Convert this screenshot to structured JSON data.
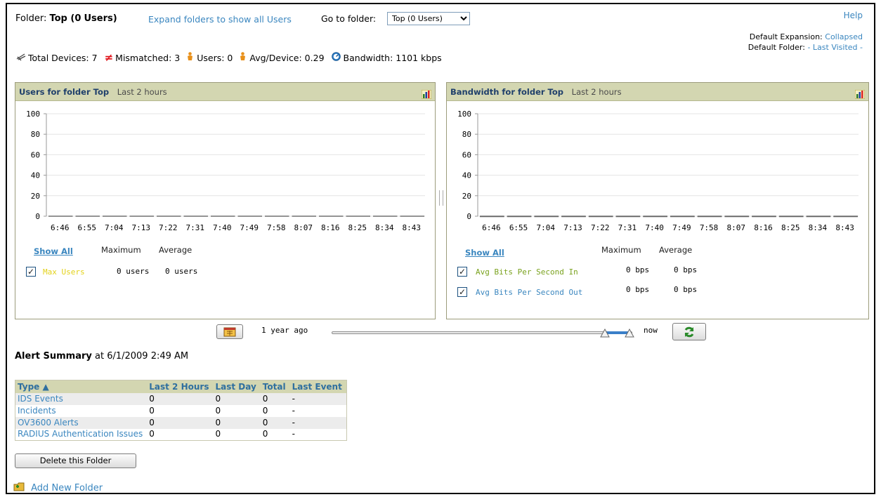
{
  "header": {
    "folder_label": "Folder:",
    "folder_name": "Top (0",
    "folder_users": "Users)",
    "expand_link": "Expand folders to show all Users",
    "goto_label": "Go to folder:",
    "goto_selected": "Top (0 Users)",
    "help_link": "Help",
    "default_expansion_label": "Default Expansion:",
    "default_expansion_value": "Collapsed",
    "default_folder_label": "Default Folder:",
    "default_folder_value": "- Last Visited -"
  },
  "stats": {
    "total_devices": "Total Devices: 7",
    "mismatched": "Mismatched: 3",
    "users": "Users: 0",
    "avg_device": "Avg/Device: 0.29",
    "bandwidth": "Bandwidth: 1101 kbps"
  },
  "users_panel": {
    "title": "Users for folder Top",
    "range": "Last 2 hours",
    "show_all": "Show All",
    "max_header": "Maximum",
    "avg_header": "Average",
    "series": [
      {
        "name": "Max Users",
        "max": "0 users",
        "avg": "0 users",
        "color": "#e3d21a"
      }
    ]
  },
  "bandwidth_panel": {
    "title": "Bandwidth for folder Top",
    "range": "Last 2 hours",
    "show_all": "Show All",
    "max_header": "Maximum",
    "avg_header": "Average",
    "series": [
      {
        "name": "Avg Bits Per Second In",
        "max": "0 bps",
        "avg": "0 bps",
        "color": "#7aa21e"
      },
      {
        "name": "Avg Bits Per Second Out",
        "max": "0 bps",
        "avg": "0 bps",
        "color": "#3a86bf"
      }
    ]
  },
  "chart_data": [
    {
      "type": "line",
      "title": "Users for folder Top",
      "x": [
        "6:46",
        "6:55",
        "7:04",
        "7:13",
        "7:22",
        "7:31",
        "7:40",
        "7:49",
        "7:58",
        "8:07",
        "8:16",
        "8:25",
        "8:34",
        "8:43"
      ],
      "yticks": [
        0,
        20,
        40,
        60,
        80,
        100
      ],
      "ylim": [
        0,
        100
      ],
      "grid": true,
      "series": [
        {
          "name": "Max Users",
          "values": [
            0,
            0,
            0,
            0,
            0,
            0,
            0,
            0,
            0,
            0,
            0,
            0,
            0,
            0
          ]
        }
      ]
    },
    {
      "type": "line",
      "title": "Bandwidth for folder Top",
      "x": [
        "6:46",
        "6:55",
        "7:04",
        "7:13",
        "7:22",
        "7:31",
        "7:40",
        "7:49",
        "7:58",
        "8:07",
        "8:16",
        "8:25",
        "8:34",
        "8:43"
      ],
      "yticks": [
        0,
        20,
        40,
        60,
        80,
        100
      ],
      "ylim": [
        0,
        100
      ],
      "grid": true,
      "series": [
        {
          "name": "Avg Bits Per Second In",
          "values": [
            0,
            0,
            0,
            0,
            0,
            0,
            0,
            0,
            0,
            0,
            0,
            0,
            0,
            0
          ]
        },
        {
          "name": "Avg Bits Per Second Out",
          "values": [
            0,
            0,
            0,
            0,
            0,
            0,
            0,
            0,
            0,
            0,
            0,
            0,
            0,
            0
          ]
        }
      ]
    }
  ],
  "timeline": {
    "start_label": "1 year ago",
    "end_label": "now"
  },
  "alerts": {
    "title": "Alert Summary",
    "timestamp": "at 6/1/2009 2:49 AM",
    "columns": [
      "Type ▲",
      "Last 2 Hours",
      "Last Day",
      "Total",
      "Last Event"
    ],
    "rows": [
      [
        "IDS Events",
        "0",
        "0",
        "0",
        "-"
      ],
      [
        "Incidents",
        "0",
        "0",
        "0",
        "-"
      ],
      [
        "OV3600 Alerts",
        "0",
        "0",
        "0",
        "-"
      ],
      [
        "RADIUS Authentication Issues",
        "0",
        "0",
        "0",
        "-"
      ]
    ]
  },
  "actions": {
    "delete_folder": "Delete this Folder",
    "add_folder": "Add New Folder"
  }
}
